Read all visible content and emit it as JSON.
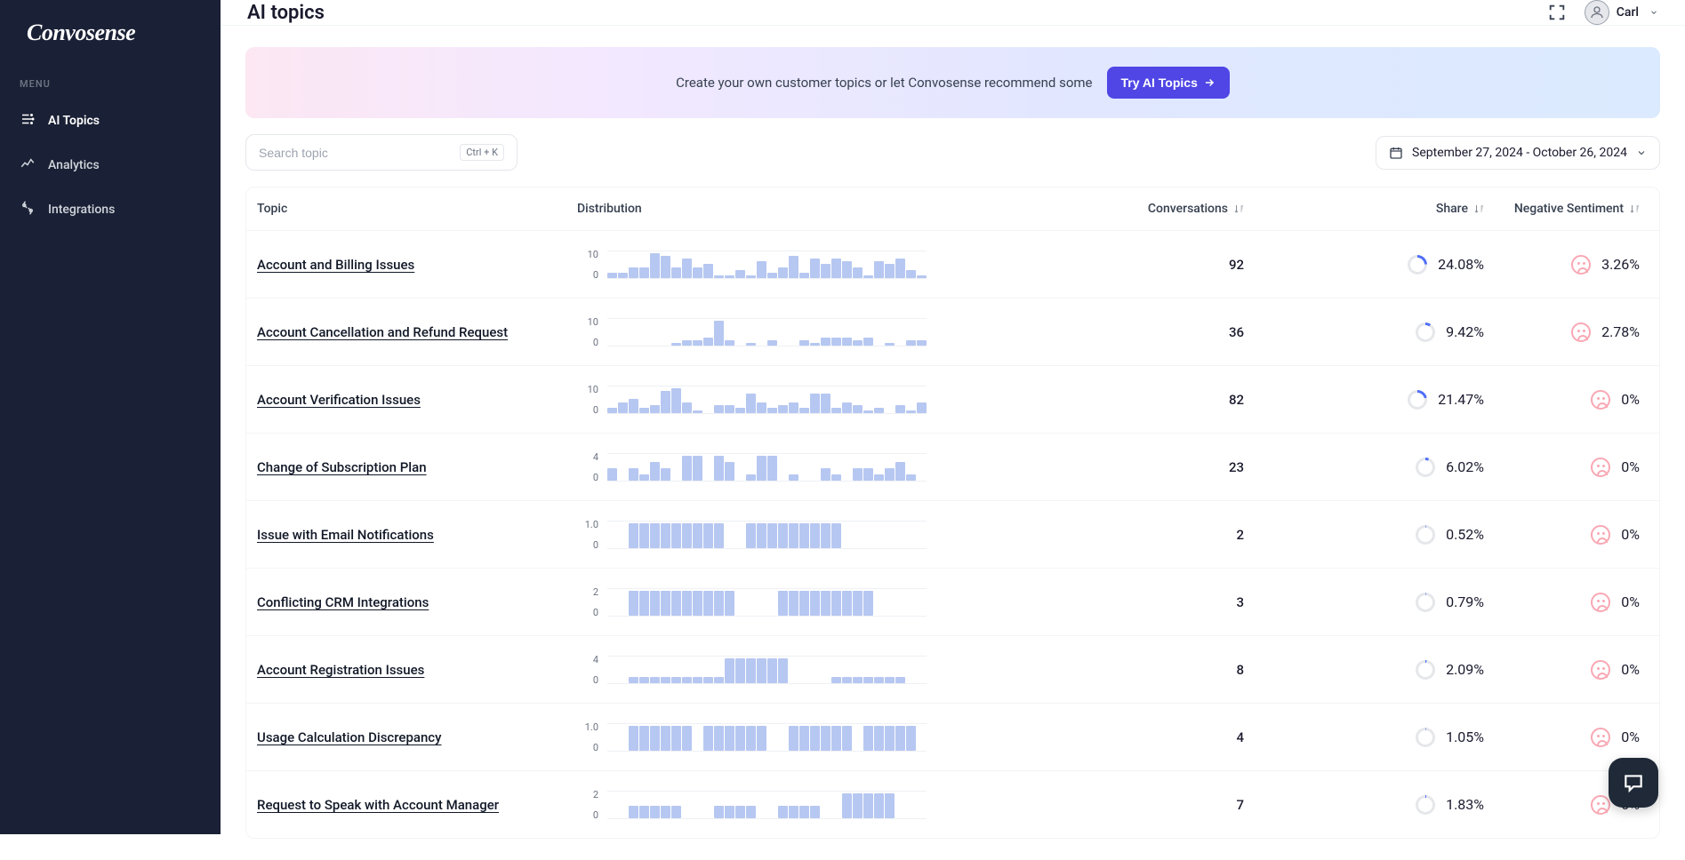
{
  "brand": "Convosense",
  "menu_label": "MENU",
  "nav": [
    {
      "label": "AI Topics",
      "active": true
    },
    {
      "label": "Analytics",
      "active": false
    },
    {
      "label": "Integrations",
      "active": false
    }
  ],
  "page_title": "AI topics",
  "user": {
    "name": "Carl"
  },
  "banner": {
    "text": "Create your own customer topics or let Convosense recommend some",
    "button": "Try AI Topics"
  },
  "search": {
    "placeholder": "Search topic",
    "shortcut": "Ctrl + K"
  },
  "date_range": "September 27, 2024 - October 26, 2024",
  "columns": {
    "topic": "Topic",
    "distribution": "Distribution",
    "conversations": "Conversations",
    "share": "Share",
    "sentiment": "Negative Sentiment"
  },
  "rows": [
    {
      "topic": "Account and Billing Issues",
      "ymax": "10",
      "bars": [
        2,
        2,
        4,
        4,
        9,
        8,
        4,
        7,
        4,
        5,
        1,
        1,
        3,
        1,
        6,
        2,
        4,
        8,
        2,
        7,
        5,
        7,
        6,
        4,
        1,
        6,
        5,
        7,
        3,
        1
      ],
      "conversations": "92",
      "share": "24.08%",
      "share_pct": 24.08,
      "sentiment": "3.26%"
    },
    {
      "topic": "Account Cancellation and Refund Request",
      "ymax": "10",
      "bars": [
        0,
        0,
        0,
        0,
        0,
        0,
        1,
        2,
        2,
        3,
        9,
        2,
        0,
        1,
        0,
        2,
        0,
        0,
        2,
        1,
        3,
        3,
        3,
        2,
        3,
        0,
        1,
        0,
        2,
        2
      ],
      "conversations": "36",
      "share": "9.42%",
      "share_pct": 9.42,
      "sentiment": "2.78%"
    },
    {
      "topic": "Account Verification Issues",
      "ymax": "10",
      "bars": [
        2,
        4,
        5,
        2,
        3,
        8,
        9,
        4,
        1,
        0,
        3,
        3,
        2,
        7,
        4,
        2,
        3,
        4,
        2,
        7,
        7,
        2,
        4,
        3,
        1,
        2,
        0,
        3,
        1,
        4
      ],
      "conversations": "82",
      "share": "21.47%",
      "share_pct": 21.47,
      "sentiment": "0%"
    },
    {
      "topic": "Change of Subscription Plan",
      "ymax": "4",
      "bars": [
        2,
        0,
        2,
        1,
        3,
        2,
        0,
        4,
        4,
        0,
        4,
        3,
        0,
        1,
        4,
        4,
        0,
        1,
        0,
        0,
        2,
        1,
        0,
        2,
        2,
        1,
        2,
        3,
        1,
        0
      ],
      "conversations": "23",
      "share": "6.02%",
      "share_pct": 6.02,
      "sentiment": "0%"
    },
    {
      "topic": "Issue with Email Notifications",
      "ymax": "1.0",
      "bars": [
        0,
        0,
        1,
        1,
        1,
        1,
        1,
        1,
        1,
        1,
        1,
        0,
        0,
        1,
        1,
        1,
        1,
        1,
        1,
        1,
        1,
        1,
        0,
        0,
        0,
        0,
        0,
        0,
        0,
        0
      ],
      "conversations": "2",
      "share": "0.52%",
      "share_pct": 0.52,
      "sentiment": "0%"
    },
    {
      "topic": "Conflicting CRM Integrations",
      "ymax": "2",
      "bars": [
        0,
        0,
        2,
        2,
        2,
        2,
        2,
        2,
        2,
        2,
        2,
        2,
        0,
        0,
        0,
        0,
        2,
        2,
        2,
        2,
        2,
        2,
        2,
        2,
        2,
        0,
        0,
        0,
        0,
        0
      ],
      "conversations": "3",
      "share": "0.79%",
      "share_pct": 0.79,
      "sentiment": "0%"
    },
    {
      "topic": "Account Registration Issues",
      "ymax": "4",
      "bars": [
        0,
        0,
        1,
        1,
        1,
        1,
        1,
        1,
        1,
        1,
        1,
        4,
        4,
        4,
        4,
        4,
        4,
        0,
        0,
        0,
        0,
        1,
        1,
        1,
        1,
        1,
        1,
        1,
        0,
        0
      ],
      "conversations": "8",
      "share": "2.09%",
      "share_pct": 2.09,
      "sentiment": "0%"
    },
    {
      "topic": "Usage Calculation Discrepancy",
      "ymax": "1.0",
      "bars": [
        0,
        0,
        1,
        1,
        1,
        1,
        1,
        1,
        0,
        1,
        1,
        1,
        1,
        1,
        1,
        0,
        0,
        1,
        1,
        1,
        1,
        1,
        1,
        0,
        1,
        1,
        1,
        1,
        1,
        0
      ],
      "conversations": "4",
      "share": "1.05%",
      "share_pct": 1.05,
      "sentiment": "0%"
    },
    {
      "topic": "Request to Speak with Account Manager",
      "ymax": "2",
      "bars": [
        0,
        0,
        1,
        1,
        1,
        1,
        1,
        0,
        0,
        0,
        1,
        1,
        1,
        1,
        0,
        0,
        1,
        1,
        1,
        1,
        0,
        0,
        2,
        2,
        2,
        2,
        2,
        0,
        0,
        0
      ],
      "conversations": "7",
      "share": "1.83%",
      "share_pct": 1.83,
      "sentiment": "0%"
    }
  ],
  "y_zero": "0",
  "chart_data": {
    "type": "bar",
    "note": "Distribution sparklines per topic; shared x-axis is daily bins over the selected date range. Values are approximate heights read from pixels relative to each row's ymax.",
    "series": [
      {
        "name": "Account and Billing Issues",
        "ymax": 10,
        "values": [
          2,
          2,
          4,
          4,
          9,
          8,
          4,
          7,
          4,
          5,
          1,
          1,
          3,
          1,
          6,
          2,
          4,
          8,
          2,
          7,
          5,
          7,
          6,
          4,
          1,
          6,
          5,
          7,
          3,
          1
        ]
      },
      {
        "name": "Account Cancellation and Refund Request",
        "ymax": 10,
        "values": [
          0,
          0,
          0,
          0,
          0,
          0,
          1,
          2,
          2,
          3,
          9,
          2,
          0,
          1,
          0,
          2,
          0,
          0,
          2,
          1,
          3,
          3,
          3,
          2,
          3,
          0,
          1,
          0,
          2,
          2
        ]
      },
      {
        "name": "Account Verification Issues",
        "ymax": 10,
        "values": [
          2,
          4,
          5,
          2,
          3,
          8,
          9,
          4,
          1,
          0,
          3,
          3,
          2,
          7,
          4,
          2,
          3,
          4,
          2,
          7,
          7,
          2,
          4,
          3,
          1,
          2,
          0,
          3,
          1,
          4
        ]
      },
      {
        "name": "Change of Subscription Plan",
        "ymax": 4,
        "values": [
          2,
          0,
          2,
          1,
          3,
          2,
          0,
          4,
          4,
          0,
          4,
          3,
          0,
          1,
          4,
          4,
          0,
          1,
          0,
          0,
          2,
          1,
          0,
          2,
          2,
          1,
          2,
          3,
          1,
          0
        ]
      },
      {
        "name": "Issue with Email Notifications",
        "ymax": 1,
        "values": [
          0,
          0,
          1,
          1,
          1,
          1,
          1,
          1,
          1,
          1,
          1,
          0,
          0,
          1,
          1,
          1,
          1,
          1,
          1,
          1,
          1,
          1,
          0,
          0,
          0,
          0,
          0,
          0,
          0,
          0
        ]
      },
      {
        "name": "Conflicting CRM Integrations",
        "ymax": 2,
        "values": [
          0,
          0,
          2,
          2,
          2,
          2,
          2,
          2,
          2,
          2,
          2,
          2,
          0,
          0,
          0,
          0,
          2,
          2,
          2,
          2,
          2,
          2,
          2,
          2,
          2,
          0,
          0,
          0,
          0,
          0
        ]
      },
      {
        "name": "Account Registration Issues",
        "ymax": 4,
        "values": [
          0,
          0,
          1,
          1,
          1,
          1,
          1,
          1,
          1,
          1,
          1,
          4,
          4,
          4,
          4,
          4,
          4,
          0,
          0,
          0,
          0,
          1,
          1,
          1,
          1,
          1,
          1,
          1,
          0,
          0
        ]
      },
      {
        "name": "Usage Calculation Discrepancy",
        "ymax": 1,
        "values": [
          0,
          0,
          1,
          1,
          1,
          1,
          1,
          1,
          0,
          1,
          1,
          1,
          1,
          1,
          1,
          0,
          0,
          1,
          1,
          1,
          1,
          1,
          1,
          0,
          1,
          1,
          1,
          1,
          1,
          0
        ]
      },
      {
        "name": "Request to Speak with Account Manager",
        "ymax": 2,
        "values": [
          0,
          0,
          1,
          1,
          1,
          1,
          1,
          0,
          0,
          0,
          1,
          1,
          1,
          1,
          0,
          0,
          1,
          1,
          1,
          1,
          0,
          0,
          2,
          2,
          2,
          2,
          2,
          0,
          0,
          0
        ]
      }
    ]
  }
}
